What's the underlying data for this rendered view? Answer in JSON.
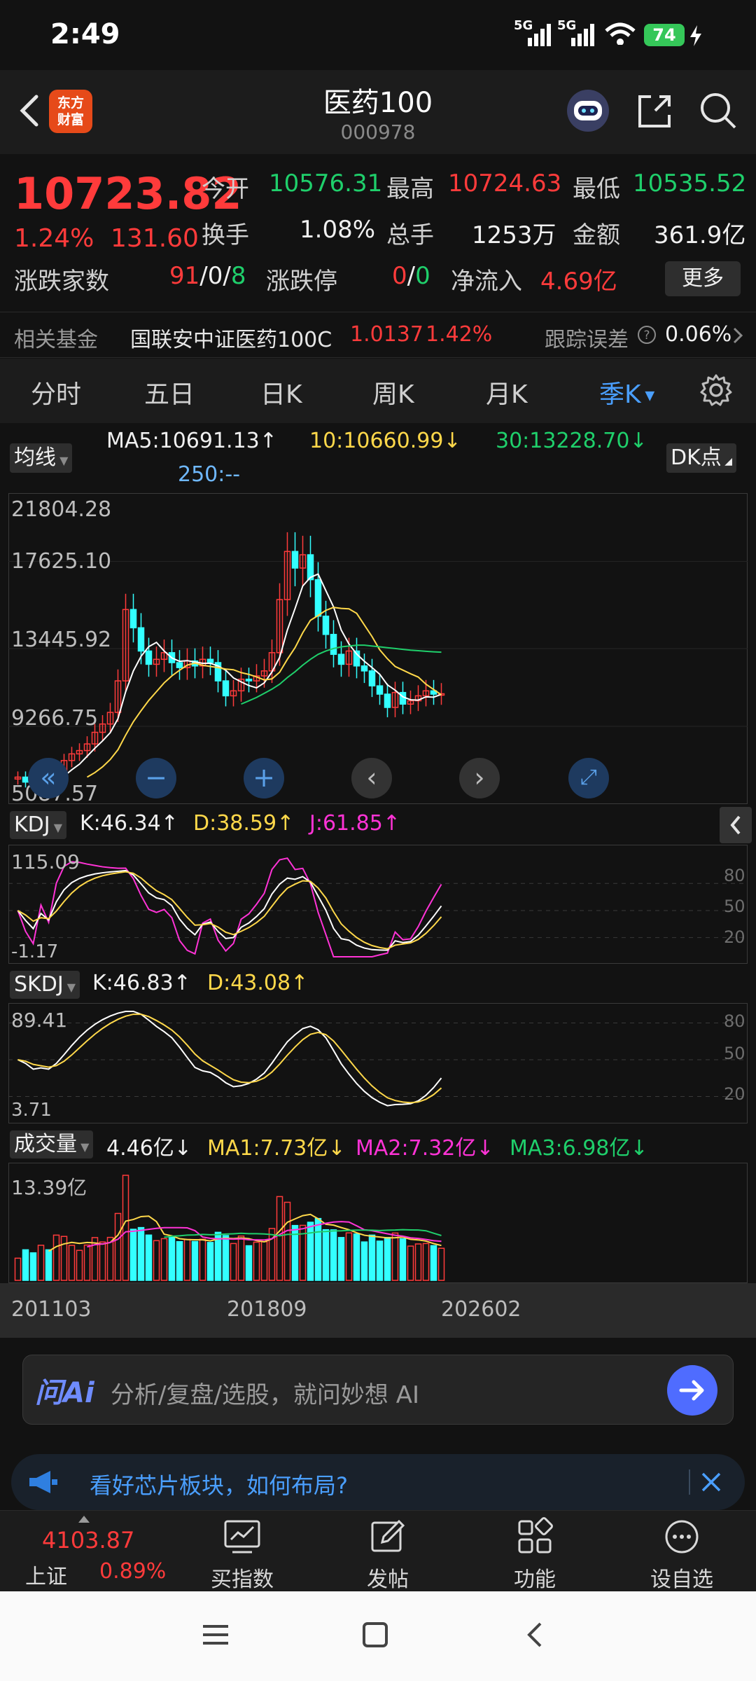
{
  "status": {
    "time": "2:49",
    "network1": "5G",
    "network2": "5G",
    "battery": "74"
  },
  "header": {
    "logo_line1": "东方",
    "logo_line2": "财富",
    "title": "医药100",
    "code": "000978"
  },
  "quote": {
    "price": "10723.82",
    "pct": "1.24%",
    "change": "131.60",
    "open_label": "今开",
    "open": "10576.31",
    "high_label": "最高",
    "high": "10724.63",
    "low_label": "最低",
    "low": "10535.52",
    "turnover_label": "换手",
    "turnover": "1.08%",
    "volume_label": "总手",
    "volume": "1253万",
    "amount_label": "金额",
    "amount": "361.9亿",
    "breadth_label": "涨跌家数",
    "up": "91",
    "flat": "0",
    "down": "8",
    "sep": "/",
    "limit_label": "涨跌停",
    "limit_up": "0",
    "limit_down": "0",
    "inflow_label": "净流入",
    "inflow": "4.69亿",
    "more": "更多"
  },
  "fund": {
    "label": "相关基金",
    "name": "国联安中证医药100C",
    "nav": "1.0137",
    "pct": "1.42%",
    "err_label": "跟踪误差",
    "err_value": "0.06%"
  },
  "tabs": [
    {
      "label": "分时"
    },
    {
      "label": "五日"
    },
    {
      "label": "日K"
    },
    {
      "label": "周K"
    },
    {
      "label": "月K"
    },
    {
      "label": "季K"
    }
  ],
  "main_chart": {
    "ma_chip": "均线",
    "ma5": "MA5:10691.13",
    "ma10": "10:10660.99",
    "ma30": "30:13228.70",
    "ma250": "250:--",
    "dk_chip": "DK点",
    "y_labels": [
      "21804.28",
      "17625.10",
      "13445.92",
      "9266.75",
      "5087.57"
    ]
  },
  "kdj": {
    "chip": "KDJ",
    "k": "K:46.34",
    "d": "D:38.59",
    "j": "J:61.85",
    "top": "115.09",
    "bottom": "-1.17",
    "levels": [
      "80",
      "50",
      "20"
    ]
  },
  "skdj": {
    "chip": "SKDJ",
    "k": "K:46.83",
    "d": "D:43.08",
    "top": "89.41",
    "bottom": "3.71",
    "levels": [
      "80",
      "50",
      "20"
    ]
  },
  "vol": {
    "chip": "成交量",
    "value": "4.46亿",
    "ma1": "MA1:7.73亿",
    "ma2": "MA2:7.32亿",
    "ma3": "MA3:6.98亿",
    "top": "13.39亿"
  },
  "dates": [
    "201103",
    "201809",
    "202602"
  ],
  "ai": {
    "logo": "问Ai",
    "placeholder": "分析/复盘/选股，就问妙想 AI"
  },
  "banner": {
    "text": "看好芯片板块，如何布局?"
  },
  "bottom": {
    "index_value": "4103.87",
    "index_name": "上证",
    "index_pct": "0.89%",
    "items": [
      {
        "label": "买指数"
      },
      {
        "label": "发帖"
      },
      {
        "label": "功能"
      },
      {
        "label": "设自选"
      }
    ]
  },
  "chart_data": {
    "type": "candlestick",
    "period": "quarterly",
    "x_ticks": [
      "201103",
      "201809",
      "202602"
    ],
    "y_ticks": [
      21804.28,
      17625.1,
      13445.92,
      9266.75,
      5087.57
    ],
    "ylim": [
      5087.57,
      21804.28
    ],
    "close": [
      5700,
      5400,
      5200,
      5600,
      5300,
      6000,
      6700,
      7100,
      7300,
      7700,
      8400,
      8900,
      9600,
      11500,
      15800,
      14700,
      13300,
      12500,
      12800,
      13200,
      12600,
      12300,
      12700,
      12400,
      12800,
      12600,
      11500,
      10600,
      10900,
      11600,
      11500,
      11800,
      12100,
      13200,
      16400,
      19300,
      18300,
      19100,
      17600,
      15400,
      14300,
      13100,
      12500,
      13300,
      12400,
      12100,
      11200,
      10700,
      9900,
      10800,
      10100,
      10300,
      10600,
      10900,
      10700,
      10724
    ],
    "ma5": [
      null,
      null,
      null,
      null,
      5440,
      5500,
      5760,
      6140,
      6480,
      6960,
      7440,
      7880,
      8380,
      9220,
      10840,
      12100,
      12980,
      13560,
      13820,
      13300,
      12880,
      12680,
      12720,
      12640,
      12560,
      12560,
      12400,
      12140,
      11680,
      11440,
      11220,
      11080,
      11380,
      12040,
      12920,
      14560,
      15860,
      17220,
      17740,
      17940,
      16940,
      15960,
      14560,
      13720,
      13120,
      12680,
      12300,
      11900,
      11260,
      10940,
      10540,
      10360,
      10340,
      10540,
      10520,
      10691
    ],
    "ma10": [
      null,
      null,
      null,
      null,
      null,
      null,
      null,
      null,
      null,
      5700,
      5970,
      6320,
      6760,
      7350,
      8230,
      9040,
      9700,
      10320,
      10850,
      11380,
      11800,
      12140,
      12450,
      12570,
      12440,
      12370,
      12300,
      12210,
      12170,
      12000,
      11890,
      11740,
      11560,
      11620,
      12020,
      12800,
      13500,
      14400,
      15150,
      15440,
      15750,
      15930,
      15870,
      15840,
      15570,
      14870,
      14170,
      13370,
      12830,
      12370,
      12150,
      11930,
      11730,
      11300,
      10980,
      10661
    ],
    "ma30": [
      null,
      null,
      null,
      null,
      null,
      null,
      null,
      null,
      null,
      null,
      null,
      null,
      null,
      null,
      null,
      null,
      null,
      null,
      null,
      null,
      null,
      null,
      null,
      null,
      null,
      null,
      null,
      null,
      null,
      10100,
      10300,
      10500,
      10750,
      11000,
      11300,
      11700,
      12050,
      12450,
      12800,
      13100,
      13300,
      13450,
      13550,
      13600,
      13650,
      13650,
      13600,
      13550,
      13500,
      13450,
      13400,
      13350,
      13320,
      13280,
      13250,
      13228.7
    ],
    "kdj": {
      "K": 46.34,
      "D": 38.59,
      "J": 61.85,
      "range": [
        -1.17,
        115.09
      ]
    },
    "skdj": {
      "K": 46.83,
      "D": 43.08,
      "range": [
        3.71,
        89.41
      ]
    },
    "volume": {
      "top": "13.39亿",
      "last": "4.46亿",
      "MA1": "7.73亿",
      "MA2": "7.32亿",
      "MA3": "6.98亿"
    }
  }
}
